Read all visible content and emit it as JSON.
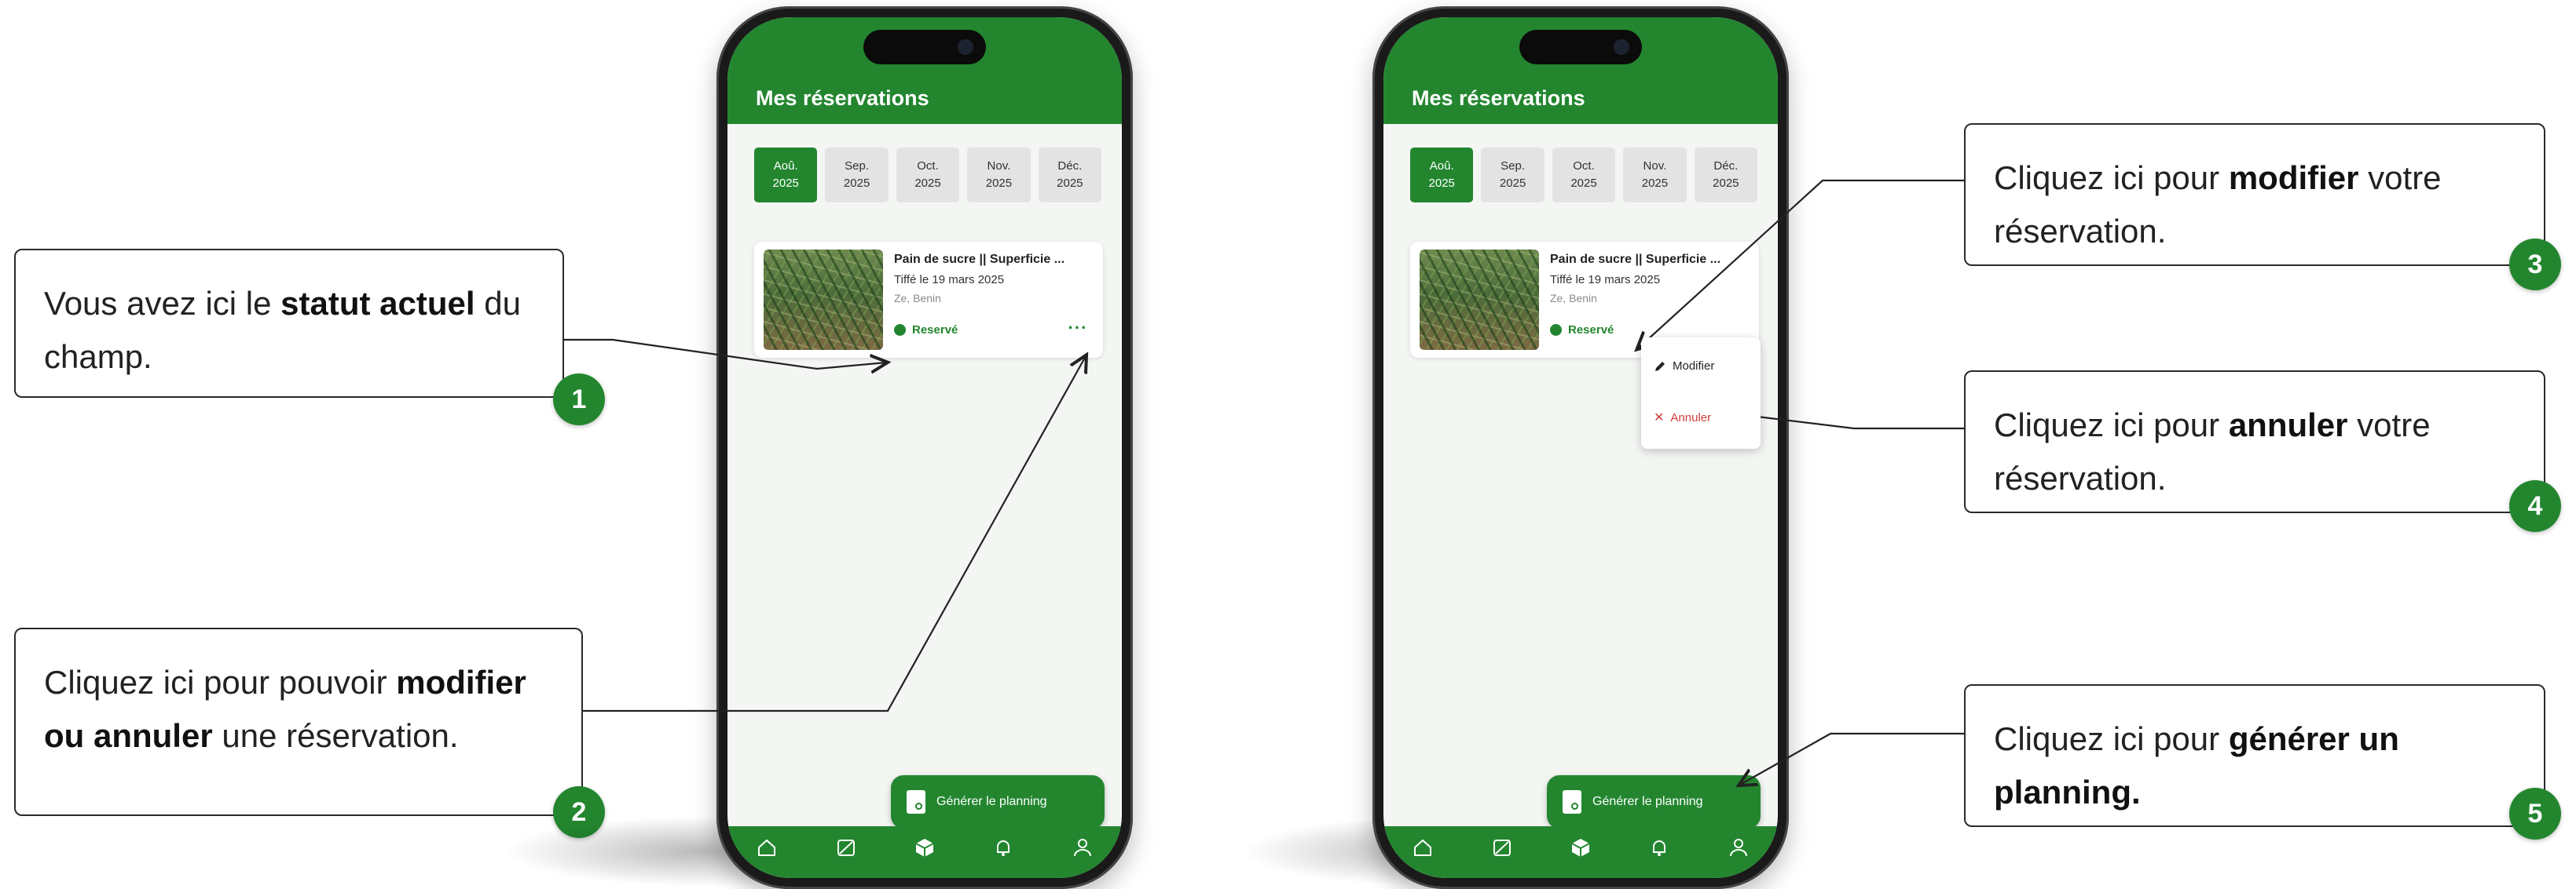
{
  "callouts": [
    {
      "number": "1",
      "parts": [
        {
          "t": "Vous avez ici le ",
          "b": false
        },
        {
          "t": "statut actuel",
          "b": true
        },
        {
          "t": " du champ.",
          "b": false
        }
      ]
    },
    {
      "number": "2",
      "parts": [
        {
          "t": "Cliquez ici pour pouvoir ",
          "b": false
        },
        {
          "t": "modifier ou annuler",
          "b": true
        },
        {
          "t": " une réservation.",
          "b": false
        }
      ]
    },
    {
      "number": "3",
      "parts": [
        {
          "t": "Cliquez ici pour ",
          "b": false
        },
        {
          "t": "modifier",
          "b": true
        },
        {
          "t": " votre réservation.",
          "b": false
        }
      ]
    },
    {
      "number": "4",
      "parts": [
        {
          "t": "Cliquez ici pour ",
          "b": false
        },
        {
          "t": "annuler",
          "b": true
        },
        {
          "t": " votre réservation.",
          "b": false
        }
      ]
    },
    {
      "number": "5",
      "parts": [
        {
          "t": "Cliquez ici pour ",
          "b": false
        },
        {
          "t": "générer un planning.",
          "b": true
        }
      ]
    }
  ],
  "app": {
    "title": "Mes réservations",
    "months": [
      {
        "month": "Aoû.",
        "year": "2025",
        "active": true
      },
      {
        "month": "Sep.",
        "year": "2025",
        "active": false
      },
      {
        "month": "Oct.",
        "year": "2025",
        "active": false
      },
      {
        "month": "Nov.",
        "year": "2025",
        "active": false
      },
      {
        "month": "Déc.",
        "year": "2025",
        "active": false
      }
    ],
    "card": {
      "title": "Pain de sucre || Superficie ...",
      "date": "Tiffé le 19 mars 2025",
      "location": "Ze, Benin",
      "status": "Reservé",
      "more": "···"
    },
    "menu": {
      "edit": "Modifier",
      "cancel": "Annuler"
    },
    "fab": "Générer le planning",
    "tabs": [
      "home-icon",
      "map-icon",
      "box-icon",
      "bell-icon",
      "user-icon"
    ]
  },
  "colors": {
    "brand": "#23862f",
    "danger": "#d23c3c"
  }
}
